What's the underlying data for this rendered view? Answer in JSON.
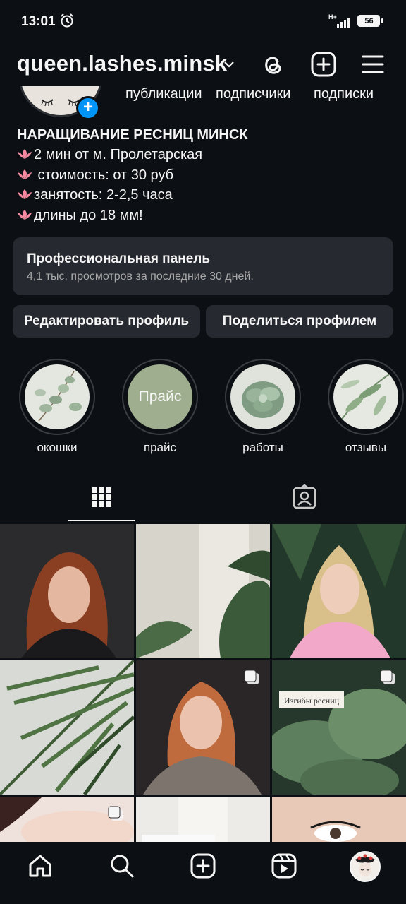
{
  "status_bar": {
    "time": "13:01",
    "network": "H+",
    "battery": "56"
  },
  "header": {
    "username": "queen.lashes.minsk"
  },
  "stats": {
    "posts_label": "публикации",
    "followers_label": "подписчики",
    "following_label": "подписки"
  },
  "bio": {
    "name": "НАРАЩИВАНИЕ РЕСНИЦ МИНСК",
    "lines": [
      "2 мин от м. Пролетарская",
      " стоимость: от 30 руб",
      "занятость: 2-2,5 часа",
      "длины до 18 мм!"
    ]
  },
  "pro_panel": {
    "title": "Профессиональная панель",
    "subtitle": "4,1 тыс. просмотров за последние 30 дней."
  },
  "buttons": {
    "edit": "Редактировать профиль",
    "share": "Поделиться профилем"
  },
  "highlights": [
    {
      "label": "окошки",
      "icon": "eucalyptus"
    },
    {
      "label": "прайс",
      "inner_text": "Прайс",
      "icon": "price-circle"
    },
    {
      "label": "работы",
      "icon": "succulent"
    },
    {
      "label": "отзывы",
      "icon": "leaves"
    }
  ],
  "tabs": [
    {
      "name": "grid",
      "icon": "grid-icon",
      "selected": true
    },
    {
      "name": "tagged",
      "icon": "tagged-person-icon",
      "selected": false
    }
  ],
  "grid_posts": [
    {
      "kind": "portrait-redhair",
      "multi": false
    },
    {
      "kind": "curtain-monstera",
      "multi": false
    },
    {
      "kind": "portrait-blonde-pink",
      "multi": false
    },
    {
      "kind": "palm-leaves",
      "multi": false
    },
    {
      "kind": "portrait-ginger",
      "multi": true
    },
    {
      "kind": "hosta-leaves",
      "multi": true,
      "caption": "Изгибы ресниц"
    },
    {
      "kind": "closeup-eye",
      "multi": true
    },
    {
      "kind": "white-text-card",
      "multi": false
    },
    {
      "kind": "closeup-lashes",
      "multi": false
    }
  ],
  "colors": {
    "background": "#0c1014",
    "surface": "#262a30",
    "accent": "#0095f6",
    "muted_text": "#a8a8a8"
  },
  "bottom_nav": [
    "home-icon",
    "search-icon",
    "create-icon",
    "reels-icon",
    "profile-avatar"
  ]
}
